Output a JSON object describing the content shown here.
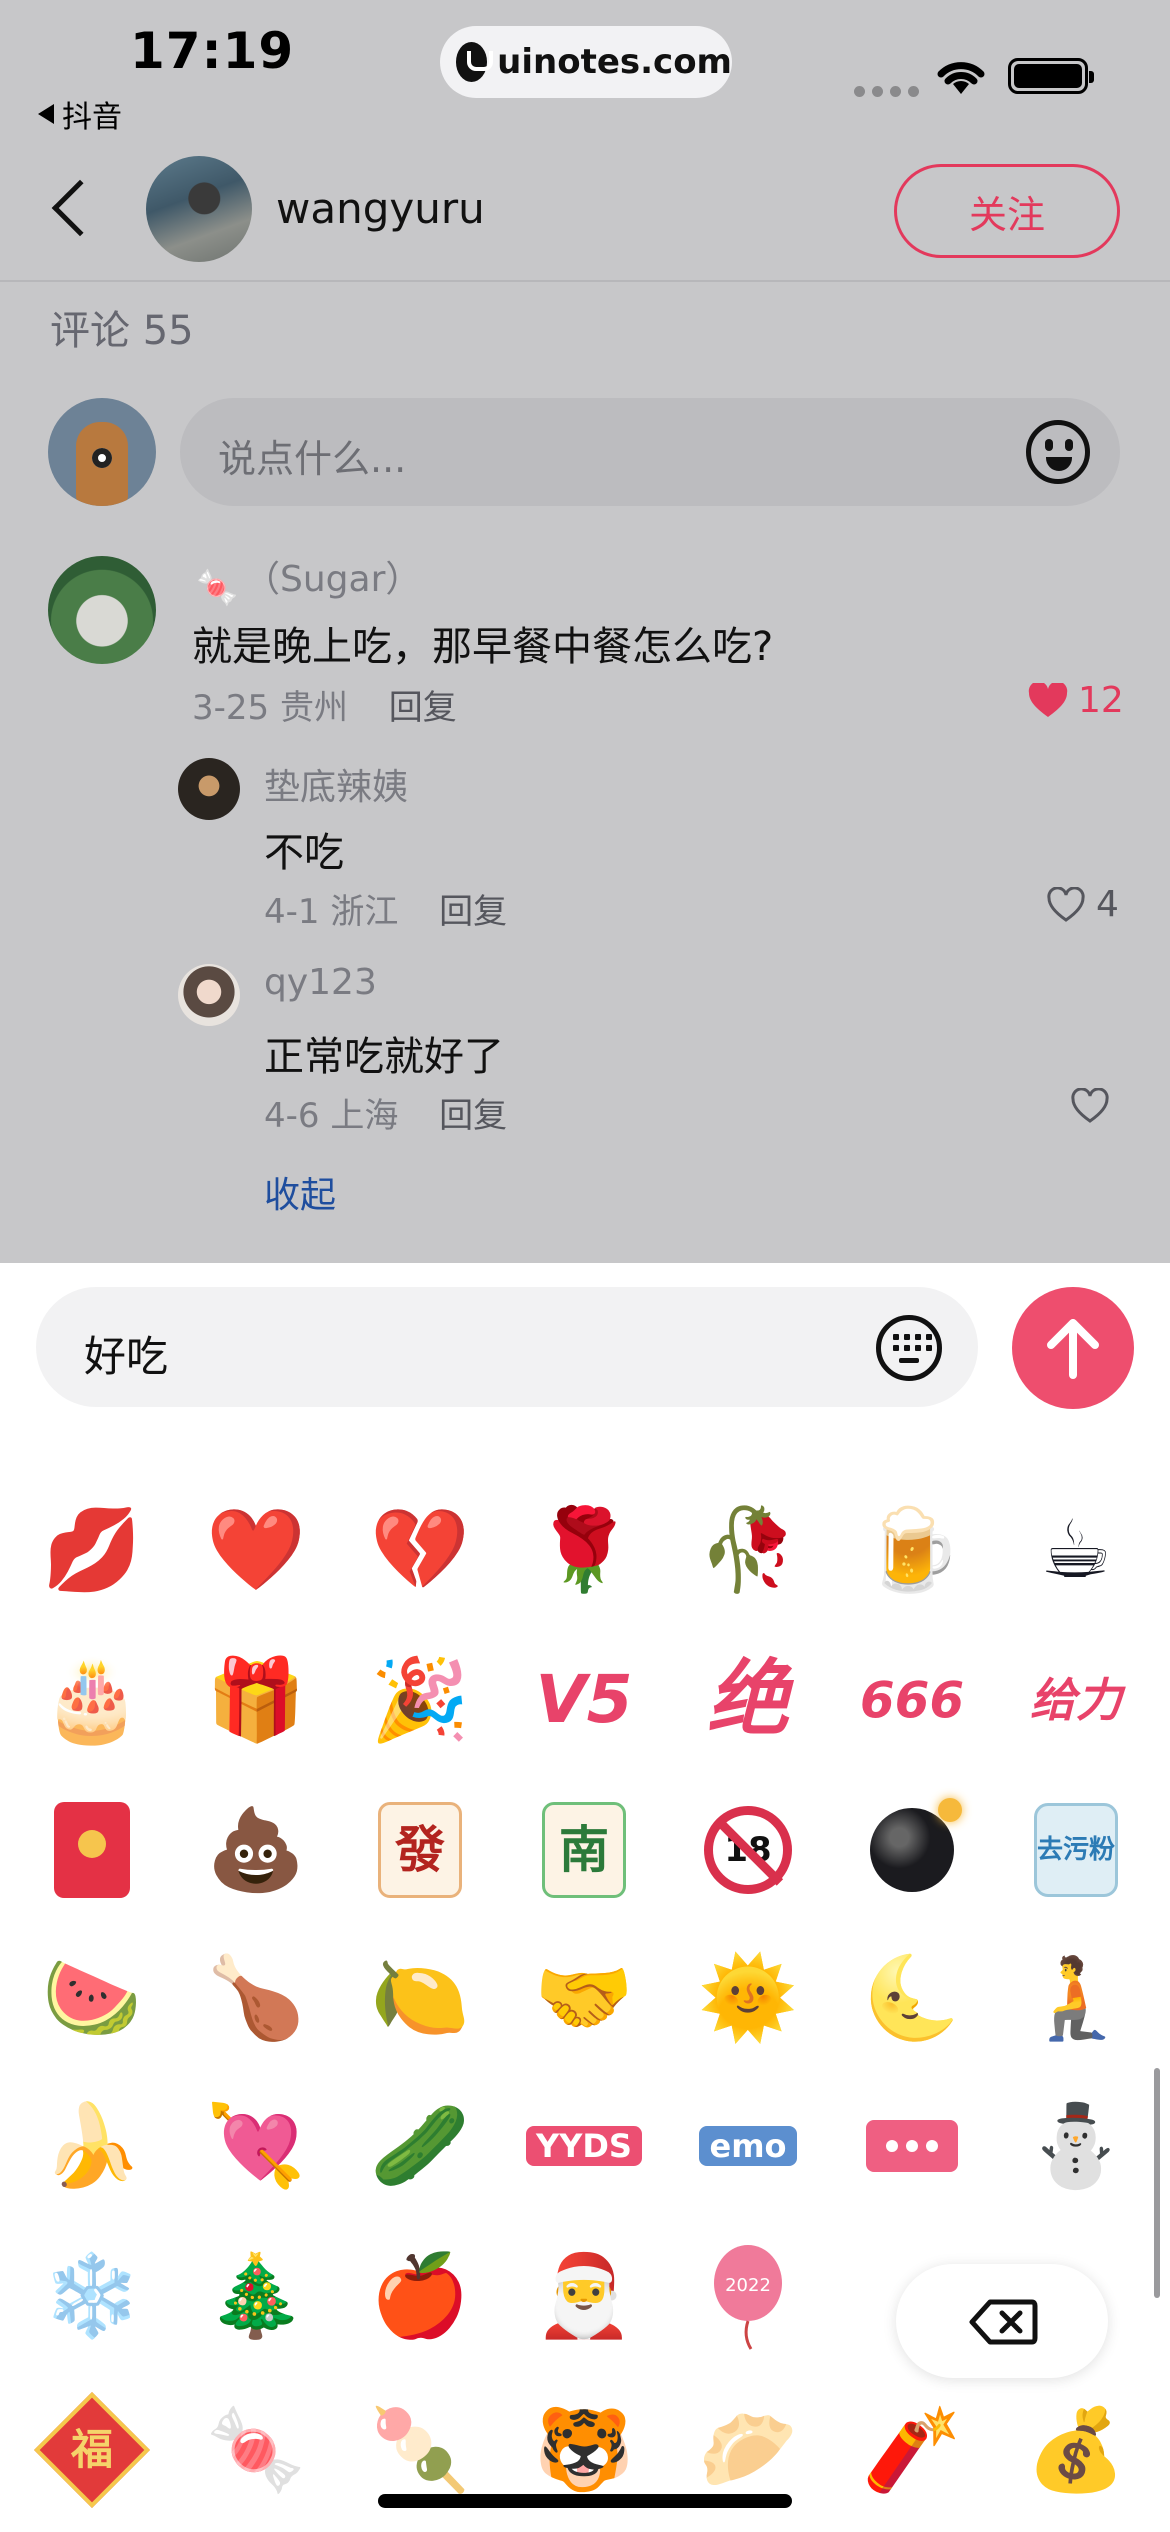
{
  "status_bar": {
    "time": "17:19",
    "back_app": "抖音",
    "url": "uinotes.com"
  },
  "header": {
    "author_name": "wangyuru",
    "follow_label": "关注"
  },
  "comments_header": {
    "count_label": "评论 55"
  },
  "composer": {
    "placeholder": "说点什么..."
  },
  "comments": [
    {
      "user": "（Sugar）",
      "text": "就是晚上吃，那早餐中餐怎么吃?",
      "date": "3-25",
      "location": "贵州",
      "reply_label": "回复",
      "likes": "12",
      "liked": true
    }
  ],
  "replies": [
    {
      "user": "垫底辣姨",
      "text": "不吃",
      "date": "4-1",
      "location": "浙江",
      "reply_label": "回复",
      "likes": "4",
      "liked": false
    },
    {
      "user": "qy123",
      "text": "正常吃就好了",
      "date": "4-6",
      "location": "上海",
      "reply_label": "回复",
      "likes": "",
      "liked": false
    }
  ],
  "collapse_label": "收起",
  "input": {
    "value": "好吃"
  },
  "emoji_grid": [
    [
      "lips",
      "heart",
      "broken-heart",
      "rose",
      "wilted-flower",
      "beer",
      "coffee"
    ],
    [
      "cake",
      "gift",
      "party-popper",
      "V5",
      "绝",
      "666",
      "给力"
    ],
    [
      "red-envelope",
      "poop",
      "mahjong-fa",
      "mahjong-nan",
      "no-18",
      "bomb",
      "detergent"
    ],
    [
      "watermelon",
      "drumstick",
      "lemon",
      "handshake",
      "sun",
      "moon",
      "kneeling-person"
    ],
    [
      "banana",
      "heart-arrow",
      "cucumber",
      "YYDS",
      "emo",
      "dots",
      "snowman"
    ],
    [
      "snowflake",
      "christmas-tree",
      "apple",
      "santa-hat",
      "balloon",
      "",
      ""
    ],
    [
      "fu",
      "candy",
      "tanghulu",
      "tiger",
      "dumpling",
      "firecracker",
      "gold-ingot"
    ]
  ],
  "emoji_labels": {
    "v5": "V5",
    "jue": "绝",
    "six": "666",
    "geili": "给力",
    "fa": "發",
    "nan": "南",
    "eighteen": "18",
    "detergent": "去污粉",
    "yyds": "YYDS",
    "emo": "emo",
    "balloon_year": "2022",
    "fu": "福"
  },
  "colors": {
    "accent": "#e3395c",
    "send_button": "#ee4e6e",
    "dim_overlay": "#c7c7c9",
    "link": "#1f4e9e"
  }
}
